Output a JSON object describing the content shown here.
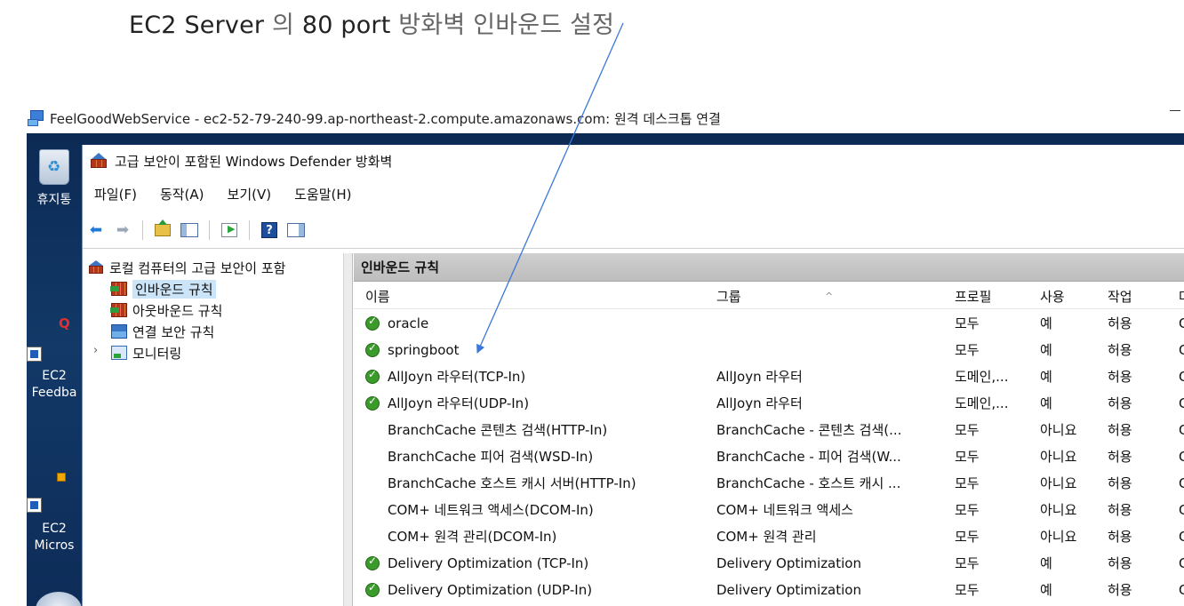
{
  "caption": {
    "part1": "EC2 Server",
    "part2": " 의 ",
    "part3": "80 port",
    "part4": " 방화벽 인바운드 설정"
  },
  "rdp": {
    "title": "FeelGoodWebService - ec2-52-79-240-99.ap-northeast-2.compute.amazonaws.com: 원격 데스크톱 연결",
    "minimize_glyph": "–"
  },
  "desktop": {
    "icons": [
      {
        "label": "휴지통"
      },
      {
        "label_line1": "EC2",
        "label_line2": "Feedba"
      },
      {
        "label_line1": "EC2",
        "label_line2": "Micros"
      }
    ]
  },
  "firewall": {
    "title": "고급 보안이 포함된 Windows Defender 방화벽",
    "menu": [
      "파일(F)",
      "동작(A)",
      "보기(V)",
      "도움말(H)"
    ],
    "toolbar": {
      "back": "back-icon",
      "forward": "forward-icon",
      "help_glyph": "?"
    },
    "tree": {
      "root": "로컬 컴퓨터의 고급 보안이 포함",
      "items": [
        "인바운드 규칙",
        "아웃바운드 규칙",
        "연결 보안 규칙",
        "모니터링"
      ],
      "caret": "›"
    },
    "rules_pane": {
      "heading": "인바운드 규칙",
      "columns": {
        "name": "이름",
        "group": "그룹",
        "profile": "프로필",
        "enabled": "사용",
        "action": "작업",
        "more": "다"
      },
      "rows": [
        {
          "name": "oracle",
          "group": "",
          "profile": "모두",
          "enabled": "예",
          "action": "허용",
          "more": "C",
          "on": true
        },
        {
          "name": "springboot",
          "group": "",
          "profile": "모두",
          "enabled": "예",
          "action": "허용",
          "more": "C",
          "on": true
        },
        {
          "name": "AllJoyn 라우터(TCP-In)",
          "group": "AllJoyn 라우터",
          "profile": "도메인,...",
          "enabled": "예",
          "action": "허용",
          "more": "C",
          "on": true
        },
        {
          "name": "AllJoyn 라우터(UDP-In)",
          "group": "AllJoyn 라우터",
          "profile": "도메인,...",
          "enabled": "예",
          "action": "허용",
          "more": "C",
          "on": true
        },
        {
          "name": "BranchCache 콘텐츠 검색(HTTP-In)",
          "group": "BranchCache - 콘텐츠 검색(...",
          "profile": "모두",
          "enabled": "아니요",
          "action": "허용",
          "more": "C",
          "on": false
        },
        {
          "name": "BranchCache 피어 검색(WSD-In)",
          "group": "BranchCache - 피어 검색(W...",
          "profile": "모두",
          "enabled": "아니요",
          "action": "허용",
          "more": "C",
          "on": false
        },
        {
          "name": "BranchCache 호스트 캐시 서버(HTTP-In)",
          "group": "BranchCache - 호스트 캐시 ...",
          "profile": "모두",
          "enabled": "아니요",
          "action": "허용",
          "more": "C",
          "on": false
        },
        {
          "name": "COM+ 네트워크 액세스(DCOM-In)",
          "group": "COM+ 네트워크 액세스",
          "profile": "모두",
          "enabled": "아니요",
          "action": "허용",
          "more": "C",
          "on": false
        },
        {
          "name": "COM+ 원격 관리(DCOM-In)",
          "group": "COM+ 원격 관리",
          "profile": "모두",
          "enabled": "아니요",
          "action": "허용",
          "more": "C",
          "on": false
        },
        {
          "name": "Delivery Optimization (TCP-In)",
          "group": "Delivery Optimization",
          "profile": "모두",
          "enabled": "예",
          "action": "허용",
          "more": "C",
          "on": true
        },
        {
          "name": "Delivery Optimization (UDP-In)",
          "group": "Delivery Optimization",
          "profile": "모두",
          "enabled": "예",
          "action": "허용",
          "more": "C",
          "on": true
        }
      ]
    }
  },
  "colors": {
    "annotation_arrow": "#3b78d8",
    "desktop": "#123968",
    "pane_header": "#c4c4c4",
    "selected": "#cce4f7",
    "enabled_check": "#3a9a2a"
  }
}
